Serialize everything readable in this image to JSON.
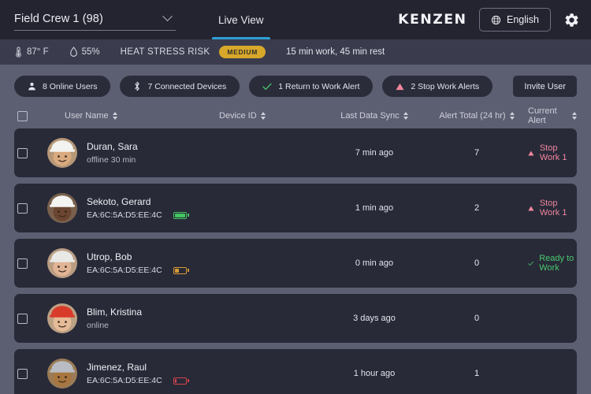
{
  "header": {
    "crew_selector": {
      "label": "Field Crew 1 (98)",
      "icon": "chevron-down-icon"
    },
    "tabs": [
      {
        "label": "Live View",
        "active": true
      }
    ],
    "logo": "KENZEN",
    "language_button": {
      "label": "English",
      "icon": "globe-icon"
    },
    "settings_icon": "gear-icon"
  },
  "stats_bar": {
    "temperature": {
      "icon": "thermometer-icon",
      "value": "87° F"
    },
    "humidity": {
      "icon": "droplet-icon",
      "value": "55%"
    },
    "heat_stress_label": "HEAT STRESS RISK",
    "heat_stress_badge": "MEDIUM",
    "work_rest": "15 min work, 45 min rest"
  },
  "chips": [
    {
      "label": "8 Online Users",
      "icon": "person-icon",
      "icon_color": "#e4e6ee"
    },
    {
      "label": "7 Connected Devices",
      "icon": "bluetooth-icon",
      "icon_color": "#e4e6ee"
    },
    {
      "label": "1 Return to Work Alert",
      "icon": "check-icon",
      "icon_color": "#49c96d"
    },
    {
      "label": "2 Stop Work Alerts",
      "icon": "warning-triangle-icon",
      "icon_color": "#f2869c"
    }
  ],
  "invite_button": "Invite User",
  "table": {
    "columns": [
      {
        "label": "User Name",
        "sortable": true
      },
      {
        "label": "Device ID",
        "sortable": true
      },
      {
        "label": "Last Data Sync",
        "sortable": true
      },
      {
        "label": "Alert Total (24 hr)",
        "sortable": true
      },
      {
        "label": "Current Alert",
        "sortable": true
      }
    ],
    "rows": [
      {
        "name": "Duran, Sara",
        "sub": "offline 30 min",
        "device_id": "",
        "battery": null,
        "last_sync": "7 min ago",
        "alert_total": "7",
        "status_text": "Stop Work 1",
        "status_type": "stop",
        "avatar": {
          "skin": "#d9a97f",
          "hat": "#f2f2f0",
          "hair": "#6b4a30"
        }
      },
      {
        "name": "Sekoto, Gerard",
        "sub": "",
        "device_id": "EA:6C:5A:D5:EE:4C",
        "battery": {
          "level": 100,
          "color": "#43c463"
        },
        "last_sync": "1 min ago",
        "alert_total": "2",
        "status_text": "Stop Work 1",
        "status_type": "stop",
        "avatar": {
          "skin": "#6b4530",
          "hat": "#f4f4f2",
          "hair": "#241a14"
        }
      },
      {
        "name": "Utrop, Bob",
        "sub": "",
        "device_id": "EA:6C:5A:D5:EE:4C",
        "battery": {
          "level": 40,
          "color": "#d89a35"
        },
        "last_sync": "0 min ago",
        "alert_total": "0",
        "status_text": "Ready to Work",
        "status_type": "ready",
        "avatar": {
          "skin": "#e0b494",
          "hat": "#e8e8e6",
          "hair": "#8c8c8a"
        }
      },
      {
        "name": "Blim, Kristina",
        "sub": "online",
        "device_id": "",
        "battery": null,
        "last_sync": "3 days ago",
        "alert_total": "0",
        "status_text": "",
        "status_type": "none",
        "avatar": {
          "skin": "#e6bb98",
          "hat": "#d93b2b",
          "hair": "#caa24a"
        }
      },
      {
        "name": "Jimenez, Raul",
        "sub": "EA:6C:5A:D5:EE:4C",
        "device_id": "EA:6C:5A:D5:EE:4C",
        "battery": {
          "level": 18,
          "color": "#d8434b"
        },
        "last_sync": "1 hour ago",
        "alert_total": "1",
        "status_text": "",
        "status_type": "none",
        "avatar": {
          "skin": "#a8763f",
          "hat": "#b9bcc2",
          "hair": "#2a1d12"
        }
      }
    ]
  },
  "colors": {
    "page_bg": "#5c5e72",
    "header_bg": "#23242f",
    "stats_bg": "#3a3c4d",
    "row_bg": "#282a38",
    "accent_blue": "#2e9fd4",
    "badge_amber": "#d8a82a",
    "alert_pink": "#f2869c",
    "ready_green": "#49c96d"
  }
}
